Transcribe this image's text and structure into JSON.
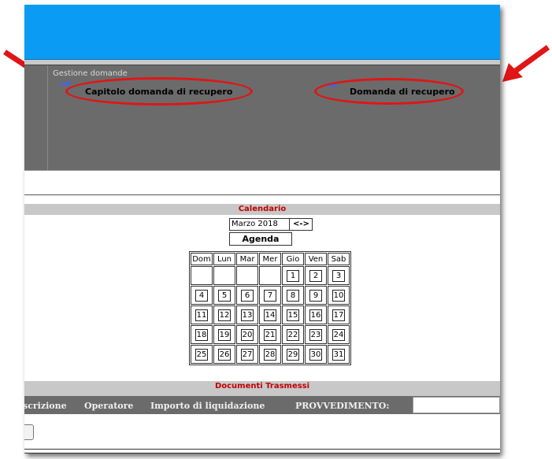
{
  "header": {
    "color": "#0a9cf5"
  },
  "gestione": {
    "title": "Gestione domande",
    "links": [
      {
        "label": "Capitolo domanda di recupero",
        "icon": "right-arrow-icon"
      },
      {
        "label": "Domanda di recupero",
        "icon": "right-arrow-icon"
      }
    ]
  },
  "calendar": {
    "section_title": "Calendario",
    "month": "Marzo 2018",
    "nav": "<->",
    "agenda": "Agenda",
    "weekdays": [
      "Dom",
      "Lun",
      "Mar",
      "Mer",
      "Gio",
      "Ven",
      "Sab"
    ],
    "weeks": [
      [
        "",
        "",
        "",
        "",
        "1",
        "2",
        "3"
      ],
      [
        "4",
        "5",
        "6",
        "7",
        "8",
        "9",
        "10"
      ],
      [
        "11",
        "12",
        "13",
        "14",
        "15",
        "16",
        "17"
      ],
      [
        "18",
        "19",
        "20",
        "21",
        "22",
        "23",
        "24"
      ],
      [
        "25",
        "26",
        "27",
        "28",
        "29",
        "30",
        "31"
      ]
    ]
  },
  "documents": {
    "section_title": "Documenti Trasmessi",
    "columns": [
      "scrizione",
      "Operatore",
      "Importo di liquidazione",
      "PROVVEDIMENTO:"
    ],
    "provvedimento_value": ""
  },
  "colors": {
    "highlight": "#e11515",
    "section_title": "#c00000",
    "panel": "#6b6b6b"
  }
}
